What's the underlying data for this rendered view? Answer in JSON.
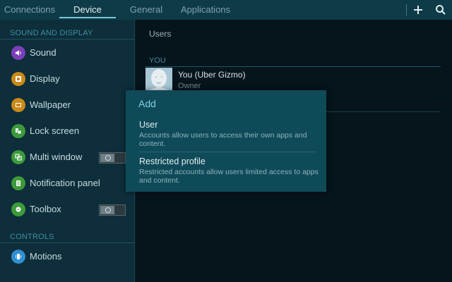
{
  "tabs": [
    {
      "label": "Connections",
      "active": false
    },
    {
      "label": "Device",
      "active": true
    },
    {
      "label": "General",
      "active": false
    },
    {
      "label": "Applications",
      "active": false
    }
  ],
  "topbar_icons": [
    "add-icon",
    "search-icon"
  ],
  "sidebar": {
    "sections": [
      {
        "header": "SOUND AND DISPLAY",
        "items": [
          {
            "label": "Sound",
            "icon": "speaker-icon",
            "color": "#7b3fb8"
          },
          {
            "label": "Display",
            "icon": "display-icon",
            "color": "#c98a1a"
          },
          {
            "label": "Wallpaper",
            "icon": "wallpaper-icon",
            "color": "#c98a1a"
          },
          {
            "label": "Lock screen",
            "icon": "lock-screen-icon",
            "color": "#3d9a3a"
          },
          {
            "label": "Multi window",
            "icon": "multi-window-icon",
            "color": "#3d9a3a",
            "toggle": "off"
          },
          {
            "label": "Notification panel",
            "icon": "notification-panel-icon",
            "color": "#3d9a3a"
          },
          {
            "label": "Toolbox",
            "icon": "toolbox-icon",
            "color": "#3d9a3a",
            "toggle": "off"
          }
        ]
      },
      {
        "header": "CONTROLS",
        "items": [
          {
            "label": "Motions",
            "icon": "motions-icon",
            "color": "#2f8fcf"
          }
        ]
      }
    ]
  },
  "main": {
    "title": "Users",
    "you_header": "YOU",
    "current_user": {
      "name": "You (Uber Gizmo)",
      "role": "Owner"
    }
  },
  "dialog": {
    "title": "Add",
    "options": [
      {
        "title": "User",
        "description": "Accounts allow users to access their own apps and content."
      },
      {
        "title": "Restricted profile",
        "description": "Restricted accounts allow users limited access to apps and content."
      }
    ]
  },
  "colors": {
    "topbar": "#0e3b48",
    "sidebar": "#0d2e3a",
    "main": "#06141b",
    "dialog": "#0f4a58",
    "accent": "#7fd0e0",
    "section_header": "#3f8fa3"
  }
}
